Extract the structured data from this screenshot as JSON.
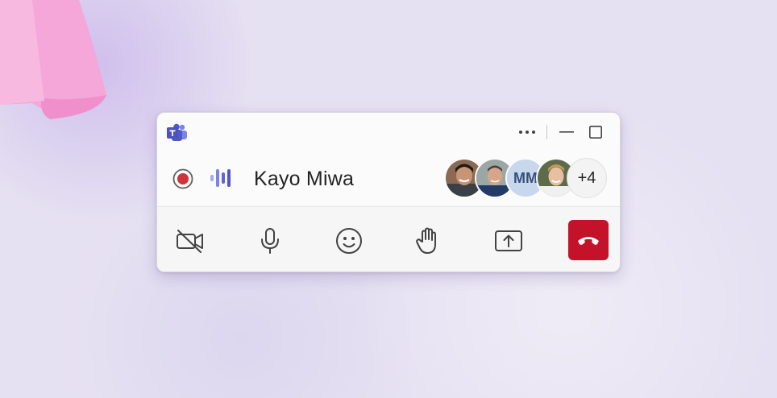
{
  "window": {
    "app_icon": "teams-logo",
    "controls": {
      "more": "more-options-icon",
      "minimize": "minimize-icon",
      "maximize": "maximize-icon"
    }
  },
  "call": {
    "recording_icon": "record-icon",
    "speaking_icon": "speaking-indicator-icon",
    "caller_name": "Kayo Miwa",
    "participants": [
      {
        "type": "photo",
        "name": "participant-1"
      },
      {
        "type": "photo",
        "name": "participant-2"
      },
      {
        "type": "initials",
        "initials": "MM"
      },
      {
        "type": "photo",
        "name": "participant-4"
      }
    ],
    "more_participants": "+4"
  },
  "toolbar": {
    "buttons": [
      "camera-off-icon",
      "microphone-icon",
      "reactions-icon",
      "raise-hand-icon",
      "share-screen-icon",
      "hang-up-icon"
    ]
  },
  "colors": {
    "accent_teams": "#5059c9",
    "record_red": "#d13438",
    "hangup_red": "#c4122a",
    "background": "#e6e1f2"
  }
}
